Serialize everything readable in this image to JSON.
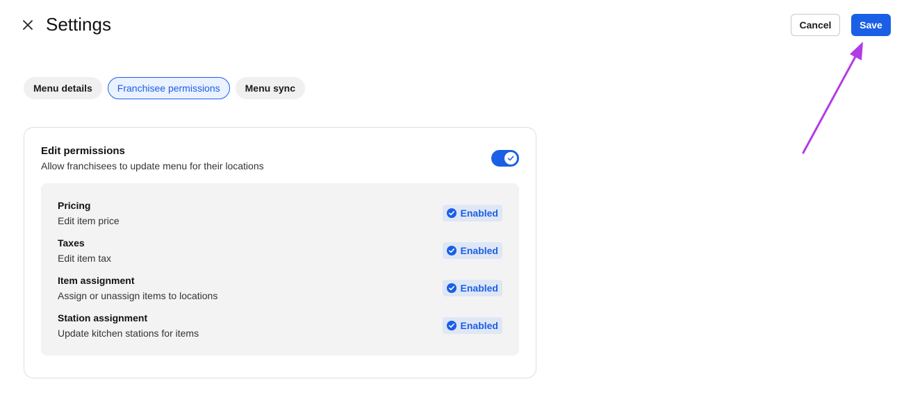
{
  "header": {
    "title": "Settings",
    "cancel_label": "Cancel",
    "save_label": "Save"
  },
  "tabs": [
    {
      "label": "Menu details",
      "active": false
    },
    {
      "label": "Franchisee permissions",
      "active": true
    },
    {
      "label": "Menu sync",
      "active": false
    }
  ],
  "card": {
    "title": "Edit permissions",
    "subtitle": "Allow franchisees to update menu for their locations",
    "toggle_on": true,
    "permissions": [
      {
        "title": "Pricing",
        "description": "Edit item price",
        "status": "Enabled"
      },
      {
        "title": "Taxes",
        "description": "Edit item tax",
        "status": "Enabled"
      },
      {
        "title": "Item assignment",
        "description": "Assign or unassign items to locations",
        "status": "Enabled"
      },
      {
        "title": "Station assignment",
        "description": "Update kitchen stations for items",
        "status": "Enabled"
      }
    ]
  },
  "colors": {
    "accent": "#1a5fe6",
    "annotation_arrow": "#b23be8"
  },
  "icons": {
    "close": "close-icon",
    "check": "check-icon",
    "badge": "check-circle-icon"
  }
}
